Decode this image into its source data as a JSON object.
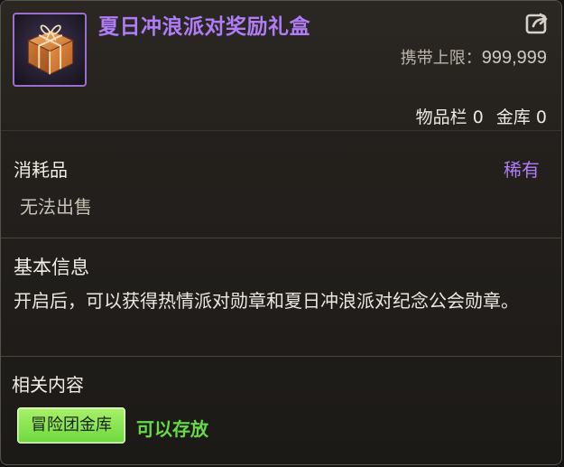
{
  "item": {
    "title": "夏日冲浪派对奖励礼盒",
    "icon": "gift-box-icon",
    "share_icon": "share-icon",
    "carry_limit_label": "携带上限：",
    "carry_limit_value": "999,999",
    "inventory_count_label": "物品栏 0",
    "storage_count_label": "金库 0"
  },
  "consumable": {
    "type_label": "消耗品",
    "rarity": "稀有",
    "sale_status": "无法出售"
  },
  "basic_info": {
    "heading": "基本信息",
    "description": "开启后，可以获得热情派对勋章和夏日冲浪派对纪念公会勋章。"
  },
  "related": {
    "heading": "相关内容",
    "storage_button": "冒险团金库",
    "storage_status": "可以存放"
  },
  "colors": {
    "rarity": "#b07cf7",
    "accent_green": "#67db45",
    "button_green": "#8ee45b"
  }
}
